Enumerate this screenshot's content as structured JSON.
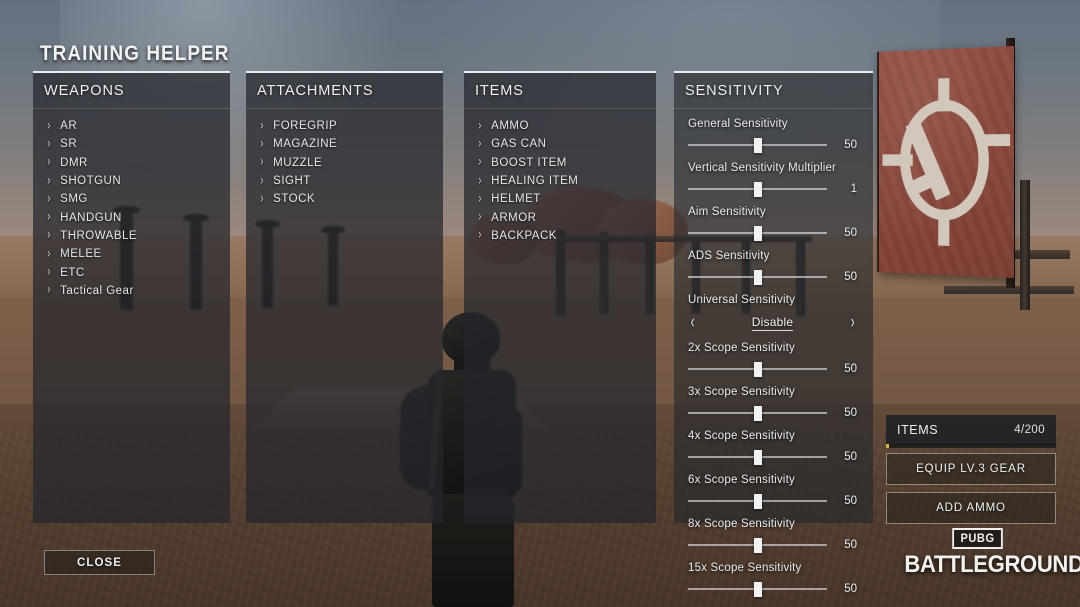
{
  "app": {
    "title": "TRAINING HELPER"
  },
  "panels": {
    "weapons": {
      "header": "WEAPONS",
      "items": [
        {
          "label": "AR"
        },
        {
          "label": "SR"
        },
        {
          "label": "DMR"
        },
        {
          "label": "SHOTGUN"
        },
        {
          "label": "SMG"
        },
        {
          "label": "HANDGUN"
        },
        {
          "label": "THROWABLE"
        },
        {
          "label": "MELEE"
        },
        {
          "label": "ETC"
        },
        {
          "label": "Tactical Gear"
        }
      ]
    },
    "attachments": {
      "header": "ATTACHMENTS",
      "items": [
        {
          "label": "FOREGRIP"
        },
        {
          "label": "MAGAZINE"
        },
        {
          "label": "MUZZLE"
        },
        {
          "label": "SIGHT"
        },
        {
          "label": "STOCK"
        }
      ]
    },
    "items": {
      "header": "ITEMS",
      "items": [
        {
          "label": "AMMO"
        },
        {
          "label": "GAS CAN"
        },
        {
          "label": "BOOST ITEM"
        },
        {
          "label": "HEALING ITEM"
        },
        {
          "label": "HELMET"
        },
        {
          "label": "ARMOR"
        },
        {
          "label": "BACKPACK"
        }
      ]
    },
    "sensitivity": {
      "header": "SENSITIVITY",
      "rows": [
        {
          "kind": "slider",
          "label": "General Sensitivity",
          "value": "50",
          "percent": 50
        },
        {
          "kind": "slider",
          "label": "Vertical Sensitivity Multiplier",
          "value": "1",
          "percent": 50
        },
        {
          "kind": "slider",
          "label": "Aim Sensitivity",
          "value": "50",
          "percent": 50
        },
        {
          "kind": "slider",
          "label": "ADS Sensitivity",
          "value": "50",
          "percent": 50
        },
        {
          "kind": "stepper",
          "label": "Universal Sensitivity",
          "value": "Disable",
          "left_arrow": "‹",
          "right_arrow": "›"
        },
        {
          "kind": "slider",
          "label": "2x Scope Sensitivity",
          "value": "50",
          "percent": 50
        },
        {
          "kind": "slider",
          "label": "3x Scope Sensitivity",
          "value": "50",
          "percent": 50
        },
        {
          "kind": "slider",
          "label": "4x Scope Sensitivity",
          "value": "50",
          "percent": 50
        },
        {
          "kind": "slider",
          "label": "6x Scope Sensitivity",
          "value": "50",
          "percent": 50
        },
        {
          "kind": "slider",
          "label": "8x Scope Sensitivity",
          "value": "50",
          "percent": 50
        },
        {
          "kind": "slider",
          "label": "15x Scope Sensitivity",
          "value": "50",
          "percent": 50
        }
      ]
    }
  },
  "sidebar": {
    "items_label": "ITEMS",
    "items_count": "4/200",
    "items_fill_percent": 2,
    "equip_gear_label": "EQUIP LV.3 GEAR",
    "add_ammo_label": "ADD AMMO"
  },
  "footer": {
    "close_label": "CLOSE"
  },
  "logo": {
    "badge": "PUBG",
    "word": "BATTLEGROUNDS"
  },
  "icons": {
    "chevron_right": "›"
  },
  "colors": {
    "panel_bg": "#24262c",
    "panel_top_border": "#e9ecef",
    "text": "#e9ebed",
    "accent_yellow": "#d9b43a",
    "sign_red": "#9c5244"
  }
}
